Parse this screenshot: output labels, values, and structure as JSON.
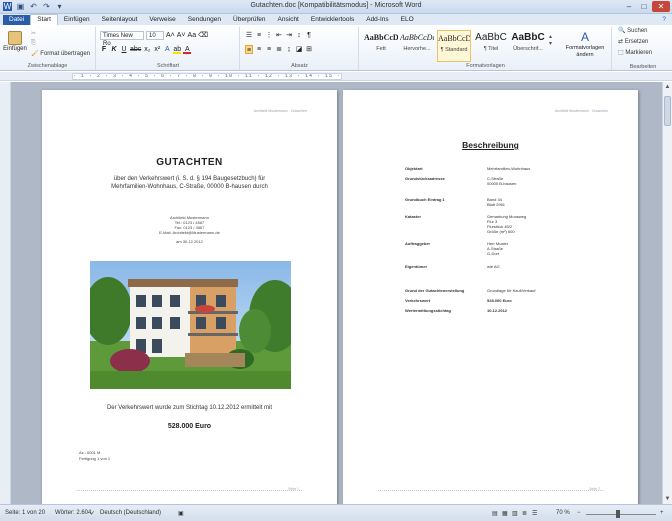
{
  "window": {
    "title": "Gutachten.doc [Kompatibilitätsmodus] - Microsoft Word"
  },
  "tabs": [
    "Datei",
    "Start",
    "Einfügen",
    "Seitenlayout",
    "Verweise",
    "Sendungen",
    "Überprüfen",
    "Ansicht",
    "Entwicklertools",
    "Add-Ins",
    "ELO"
  ],
  "ribbon": {
    "paste_label": "Einfügen",
    "format_painter": "Format übertragen",
    "group_clipboard": "Zwischenablage",
    "font_name": "Times New Ro",
    "font_size": "10",
    "group_font": "Schriftart",
    "group_paragraph": "Absatz",
    "group_styles": "Formatvorlagen",
    "group_edit": "Bearbeiten",
    "styles": [
      {
        "sample": "AaBbCcDd",
        "name": "Fett"
      },
      {
        "sample": "AaBbCcDd",
        "name": "Hervorhe..."
      },
      {
        "sample": "AaBbCcDd",
        "name": "¶ Standard"
      },
      {
        "sample": "AaBbC",
        "name": "¶ Titel"
      },
      {
        "sample": "AaBbC",
        "name": "Überschrif..."
      }
    ],
    "change_styles": "Formatvorlagen ändern",
    "search": "Suchen",
    "replace": "Ersetzen",
    "select": "Markieren"
  },
  "page1": {
    "header": "Architekt Mustermann · Gutachten",
    "title": "GUTACHTEN",
    "subtitle1": "über den Verkehrswert (i. S. d. § 194 Baugesetzbuch) für",
    "subtitle2": "Mehrfamilien-Wohnhaus, C-Straße, 00000 B-hausen durch",
    "author_lines": [
      "Architekt Mustermann",
      "Tel.: 0123 / 4567",
      "Fax: 0123 / 4567",
      "E-Mail: Architekt@Mustermann.de"
    ],
    "date_line": "am 30.12.2012",
    "result_line": "Der Verkehrswert wurde zum Stichtag 10.12.2012 ermittelt mit",
    "value": "528.000 Euro",
    "ref1": "Az.: 0001 M",
    "ref2": "Fertigung 1 von 1",
    "footer": "Seite 1"
  },
  "page2": {
    "header": "Architekt Mustermann · Gutachten",
    "heading": "Beschreibung",
    "rows": [
      {
        "k": "Objektart",
        "v": "Mehrfamilien-Wohnhaus"
      },
      {
        "k": "Grundstücksadresse",
        "v": "C-Straße"
      },
      {
        "k": "",
        "v": "00000 B-hausen"
      },
      {
        "k": "Grundbuch Eintrag 1",
        "v": "Band           34"
      },
      {
        "k": "",
        "v": "Blatt           2961"
      },
      {
        "k": "Kataster",
        "v": "Gemarkung        Moosweg"
      },
      {
        "k": "",
        "v": "Flur               3"
      },
      {
        "k": "",
        "v": "Flurstück         45/2"
      },
      {
        "k": "",
        "v": "Größe (m²)       600"
      },
      {
        "k": "Auftraggeber",
        "v": "Herr Muster"
      },
      {
        "k": "",
        "v": "A-Straße"
      },
      {
        "k": "",
        "v": "G-Dorf"
      },
      {
        "k": "Eigentümer",
        "v": "wie AG"
      },
      {
        "k": "Grund der Gutachtenerstellung",
        "v": "Grundlage für Kauf/Verkauf"
      },
      {
        "k": "Verkehrswert",
        "v": "528.000 Euro"
      },
      {
        "k": "Wertermittlungsstichtag",
        "v": "10.12.2012"
      }
    ],
    "footer": "Seite 2"
  },
  "status": {
    "page": "Seite: 1 von 20",
    "words": "Wörter: 2.604",
    "language": "Deutsch (Deutschland)",
    "zoom": "70 %",
    "zoom_fraction": 0.45
  },
  "colors": {
    "file_tab": "#2a5ca8",
    "canvas": "#aeb8c6",
    "highlight": "#fbd983"
  }
}
